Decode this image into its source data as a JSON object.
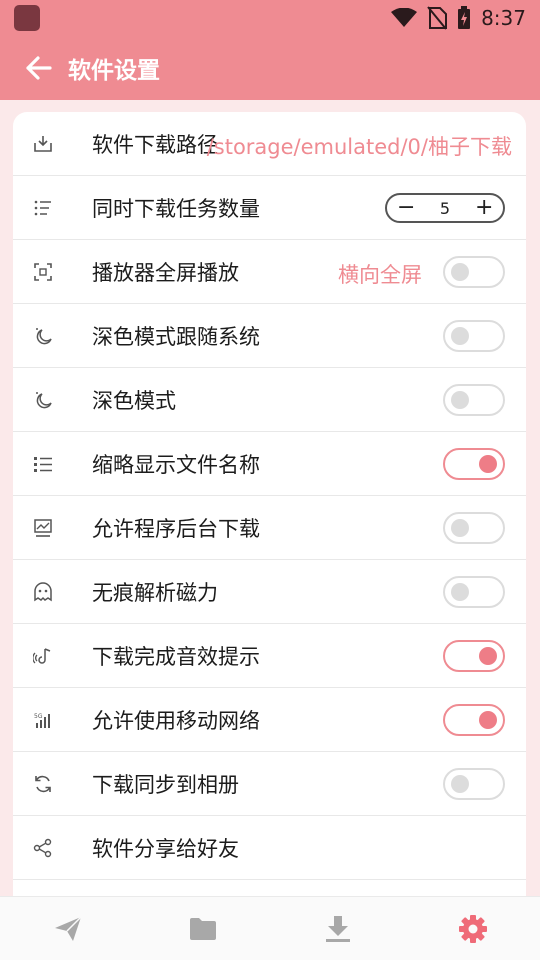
{
  "status_bar": {
    "time": "8:37",
    "app_icon": "app-icon",
    "icons": [
      "wifi-icon",
      "no-sim-icon",
      "battery-charging-icon"
    ]
  },
  "app_bar": {
    "title": "软件设置",
    "back_icon": "arrow-left-icon"
  },
  "settings": {
    "download_path": {
      "label": "软件下载路径",
      "value": "/storage/emulated/0/柚子下载",
      "icon": "download-tray-icon"
    },
    "concurrent": {
      "label": "同时下载任务数量",
      "value": "5",
      "minus": "−",
      "plus": "+",
      "icon": "list-icon"
    },
    "fullscreen": {
      "label": "播放器全屏播放",
      "value": "横向全屏",
      "on": false,
      "icon": "fullscreen-icon"
    },
    "dark_follow": {
      "label": "深色模式跟随系统",
      "on": false,
      "icon": "moon-icon"
    },
    "dark_mode": {
      "label": "深色模式",
      "on": false,
      "icon": "moon-icon"
    },
    "short_name": {
      "label": "缩略显示文件名称",
      "on": true,
      "icon": "bulleted-list-icon"
    },
    "background_dl": {
      "label": "允许程序后台下载",
      "on": false,
      "icon": "monitor-chart-icon"
    },
    "traceless": {
      "label": "无痕解析磁力",
      "on": false,
      "icon": "ghost-icon"
    },
    "sound_hint": {
      "label": "下载完成音效提示",
      "on": true,
      "icon": "sound-icon"
    },
    "mobile_net": {
      "label": "允许使用移动网络",
      "on": true,
      "icon": "signal-icon"
    },
    "sync_album": {
      "label": "下载同步到相册",
      "on": false,
      "icon": "sync-icon"
    },
    "share": {
      "label": "软件分享给好友",
      "icon": "share-icon"
    }
  },
  "bottom_nav": {
    "items": [
      "send-icon",
      "folder-icon",
      "download-icon",
      "settings-gear-icon"
    ],
    "active": "settings-gear-icon"
  },
  "colors": {
    "accent": "#ef8b92",
    "background": "#fbe9ea",
    "toggle_off": "#dcdcdc"
  }
}
